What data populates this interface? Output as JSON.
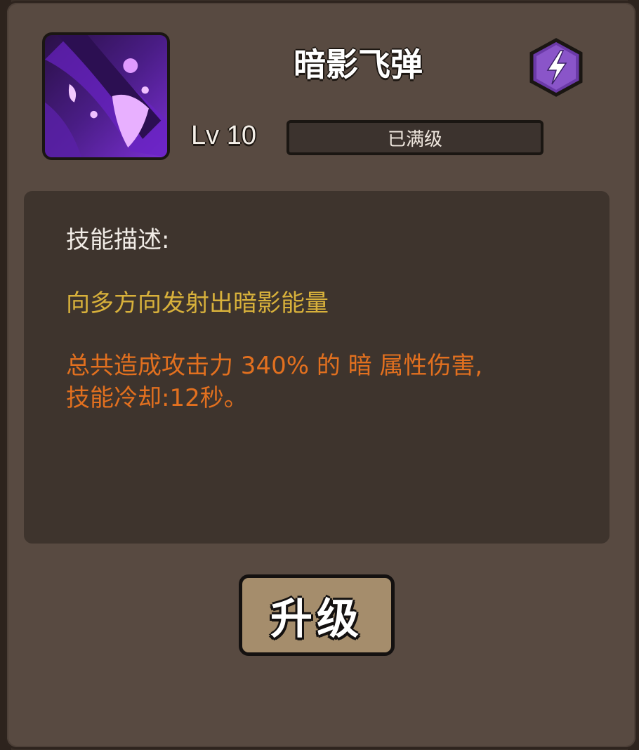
{
  "skill": {
    "name": "暗影飞弹",
    "icon": "shadow-missile-icon",
    "level_label": "Lv 10",
    "level_status": "已满级",
    "element_icon": "lightning-hexagon-icon"
  },
  "description": {
    "heading": "技能描述:",
    "summary": "向多方向发射出暗影能量",
    "effect": "总共造成攻击力 340% 的 暗 属性伤害,\n技能冷却:12秒。"
  },
  "actions": {
    "upgrade_label": "升级"
  },
  "colors": {
    "panel": "#584a41",
    "summary_text": "#d8b13b",
    "effect_text": "#e2701f",
    "button": "#a58d6c"
  }
}
